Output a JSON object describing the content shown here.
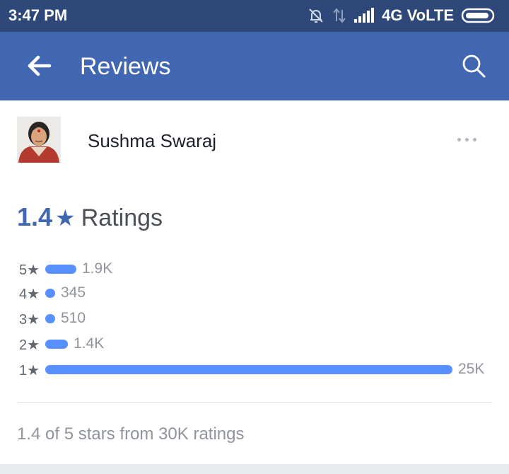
{
  "status_bar": {
    "time": "3:47 PM",
    "network": "4G VoLTE",
    "icons": [
      "notifications-off-icon",
      "data-transfer-icon",
      "signal-icon",
      "battery-icon"
    ]
  },
  "app_bar": {
    "title": "Reviews",
    "back_icon": "arrow-left-icon",
    "search_icon": "search-icon",
    "color": "#4267b2"
  },
  "profile": {
    "name": "Sushma Swaraj",
    "avatar_icon": "profile-photo",
    "more_icon": "more-icon"
  },
  "rating": {
    "value": "1.4",
    "star": "★",
    "label": "Ratings",
    "accent_color": "#4267b2",
    "bar_color": "#5890ff"
  },
  "breakdown": [
    {
      "label": "5★",
      "count_text": "1.9K",
      "count": 1900
    },
    {
      "label": "4★",
      "count_text": "345",
      "count": 345
    },
    {
      "label": "3★",
      "count_text": "510",
      "count": 510
    },
    {
      "label": "2★",
      "count_text": "1.4K",
      "count": 1400
    },
    {
      "label": "1★",
      "count_text": "25K",
      "count": 25000
    }
  ],
  "summary": "1.4 of 5 stars from 30K ratings"
}
